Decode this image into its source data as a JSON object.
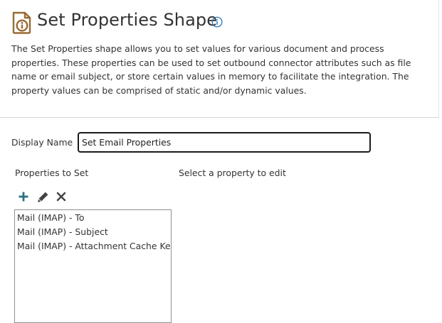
{
  "header": {
    "title": "Set Properties Shape",
    "description": "The Set Properties shape allows you to set values for various document and process properties. These properties can be used to set outbound connector attributes such as file name or email subject, or store certain values in memory to facilitate the integration. The property values can be comprised of static and/or dynamic values.",
    "icon": "set-properties-document-icon",
    "info_icon": "info-icon"
  },
  "form": {
    "display_name_label": "Display Name",
    "display_name_value": "Set Email Properties"
  },
  "properties": {
    "label": "Properties to Set",
    "edit_hint": "Select a property to edit",
    "toolbar": {
      "add_icon": "plus-icon",
      "edit_icon": "pencil-icon",
      "delete_icon": "close-icon"
    },
    "items": [
      "Mail (IMAP) - To",
      "Mail (IMAP) - Subject",
      "Mail (IMAP) - Attachment Cache Key"
    ]
  },
  "colors": {
    "icon_brown": "#9a6a33",
    "info_blue": "#1c6eb4",
    "add_teal": "#2b6f84",
    "toolbar_gray": "#444444",
    "text": "#333333"
  }
}
